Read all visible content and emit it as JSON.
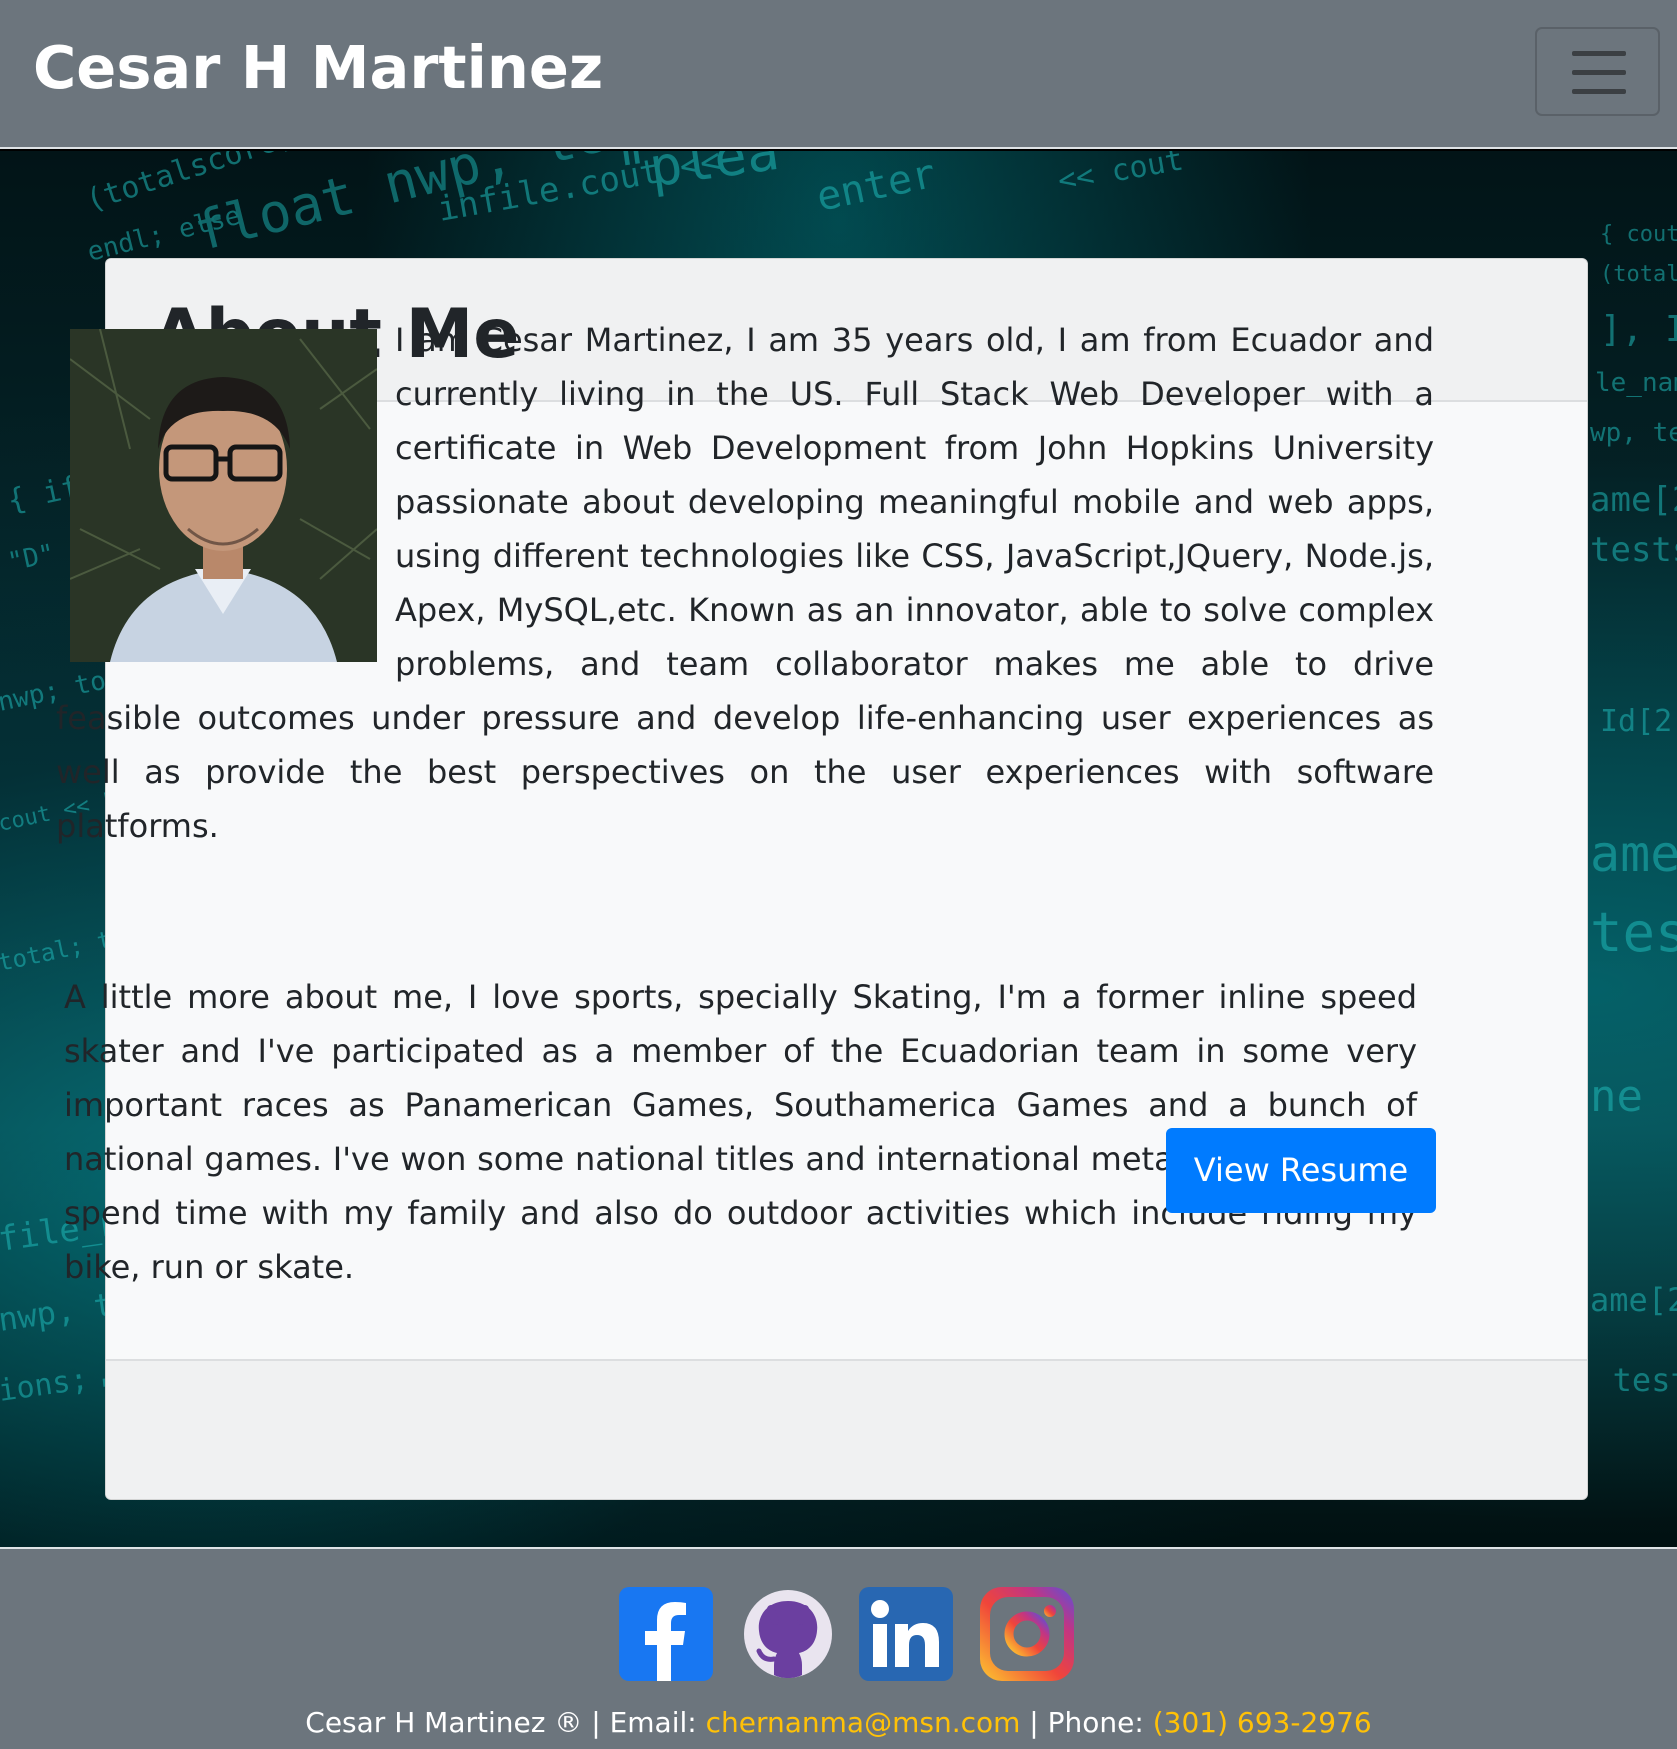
{
  "navbar": {
    "brand": "Cesar H Martinez",
    "toggler_icon": "hamburger-menu-icon"
  },
  "about": {
    "title": "About Me",
    "photo_description": "profile-photo",
    "paragraph1": "I am Cesar Martinez, I am 35 years old, I am from Ecuador and currently living in the US. Full Stack Web Developer with a certificate in Web Development from John Hopkins University passionate about developing meaningful mobile and web apps, using different technologies like CSS, JavaScript,JQuery, Node.js, Apex, MySQL,etc. Known as an innovator, able to solve complex problems, and team collaborator makes me able to drive feasible outcomes under pressure and develop life-enhancing user experiences as well as provide the best perspectives on the user experiences with software platforms.",
    "paragraph2": "A little more about me, I love sports, specially Skating, I'm a former inline speed skater and I've participated as a member of the Ecuadorian team in some very important races as Panamerican Games, Southamerica Games and a bunch of national games. I've won some national titles and international metals as well. Love spend time with my family and also do outdoor activities which include riding my bike, run or skate.",
    "resume_button": "View Resume"
  },
  "footer": {
    "social_icons": [
      "facebook-icon",
      "github-icon",
      "linkedin-icon",
      "instagram-icon"
    ],
    "owner": "Cesar H Martinez ®",
    "separator": "|",
    "email_label": "Email:",
    "email": "chernanma@msn.com",
    "phone_label": "Phone:",
    "phone": "(301) 693-2976"
  },
  "colors": {
    "navbar_bg": "#6c757d",
    "button_primary": "#007bff",
    "footer_link": "#ffc107",
    "code_glow": "#00c8c8"
  }
}
